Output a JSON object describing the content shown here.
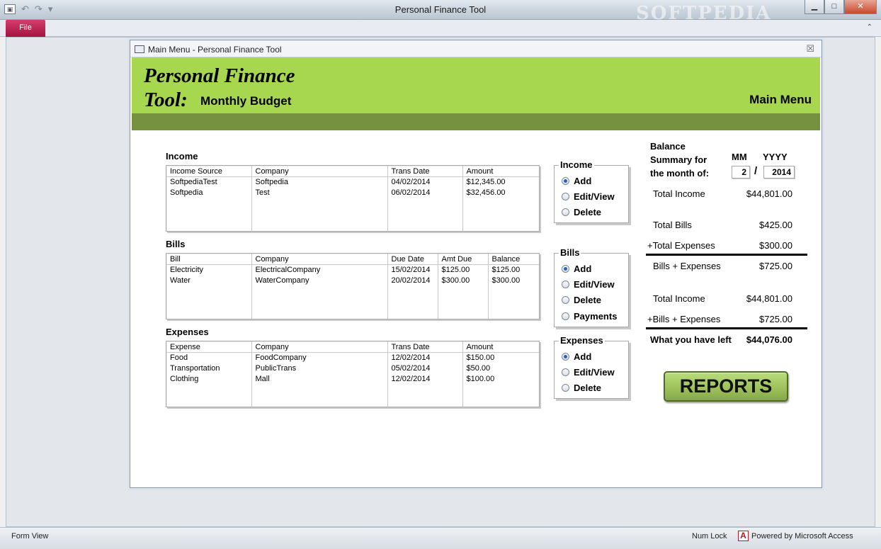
{
  "app": {
    "title": "Personal Finance Tool",
    "watermark": "SOFTPEDIA",
    "file_tab": "File",
    "window_buttons": {
      "minimize": "▁",
      "maximize": "□",
      "close": "✕"
    }
  },
  "form": {
    "title": "Main Menu - Personal Finance Tool",
    "banner": {
      "title_line1": "Personal Finance",
      "title_line2": "Tool:",
      "subtitle": "Monthly Budget",
      "main_menu": "Main Menu"
    }
  },
  "income": {
    "label": "Income",
    "columns": [
      "Income Source",
      "Company",
      "Trans Date",
      "Amount"
    ],
    "rows": [
      [
        "SoftpediaTest",
        "Softpedia",
        "04/02/2014",
        "$12,345.00"
      ],
      [
        "Softpedia",
        "Test",
        "06/02/2014",
        "$32,456.00"
      ]
    ]
  },
  "bills": {
    "label": "Bills",
    "columns": [
      "Bill",
      "Company",
      "Due Date",
      "Amt Due",
      "Balance"
    ],
    "rows": [
      [
        "Electricity",
        "ElectricalCompany",
        "15/02/2014",
        "$125.00",
        "$125.00"
      ],
      [
        "Water",
        "WaterCompany",
        "20/02/2014",
        "$300.00",
        "$300.00"
      ]
    ]
  },
  "expenses": {
    "label": "Expenses",
    "columns": [
      "Expense",
      "Company",
      "Trans Date",
      "Amount"
    ],
    "rows": [
      [
        "Food",
        "FoodCompany",
        "12/02/2014",
        "$150.00"
      ],
      [
        "Transportation",
        "PublicTrans",
        "05/02/2014",
        "$50.00"
      ],
      [
        "Clothing",
        "Mall",
        "12/02/2014",
        "$100.00"
      ]
    ]
  },
  "groups": {
    "income": {
      "label": "Income",
      "options": [
        "Add",
        "Edit/View",
        "Delete"
      ],
      "selected": "Add"
    },
    "bills": {
      "label": "Bills",
      "options": [
        "Add",
        "Edit/View",
        "Delete",
        "Payments"
      ],
      "selected": "Add"
    },
    "expenses": {
      "label": "Expenses",
      "options": [
        "Add",
        "Edit/View",
        "Delete"
      ],
      "selected": "Add"
    }
  },
  "summary": {
    "title": "Balance Summary for the month of:",
    "mm_label": "MM",
    "yyyy_label": "YYYY",
    "month": "2",
    "separator": "/",
    "year": "2014",
    "total_income_label": "Total Income",
    "total_income": "$44,801.00",
    "total_bills_label": "Total Bills",
    "total_bills": "$425.00",
    "total_expenses_label": "+Total Expenses",
    "total_expenses": "$300.00",
    "bills_expenses_label": "Bills + Expenses",
    "bills_expenses": "$725.00",
    "total_income2_label": "Total Income",
    "total_income2": "$44,801.00",
    "plus_bills_expenses_label": "+Bills + Expenses",
    "plus_bills_expenses": "$725.00",
    "left_label": "What you have left",
    "left_value": "$44,076.00",
    "reports_button": "REPORTS"
  },
  "status": {
    "view": "Form View",
    "num_lock": "Num Lock",
    "powered": "Powered by Microsoft Access",
    "access_icon": "A"
  },
  "colors": {
    "banner": "#a7d64f",
    "band": "#76913f",
    "file_tab": "#c2185b"
  }
}
